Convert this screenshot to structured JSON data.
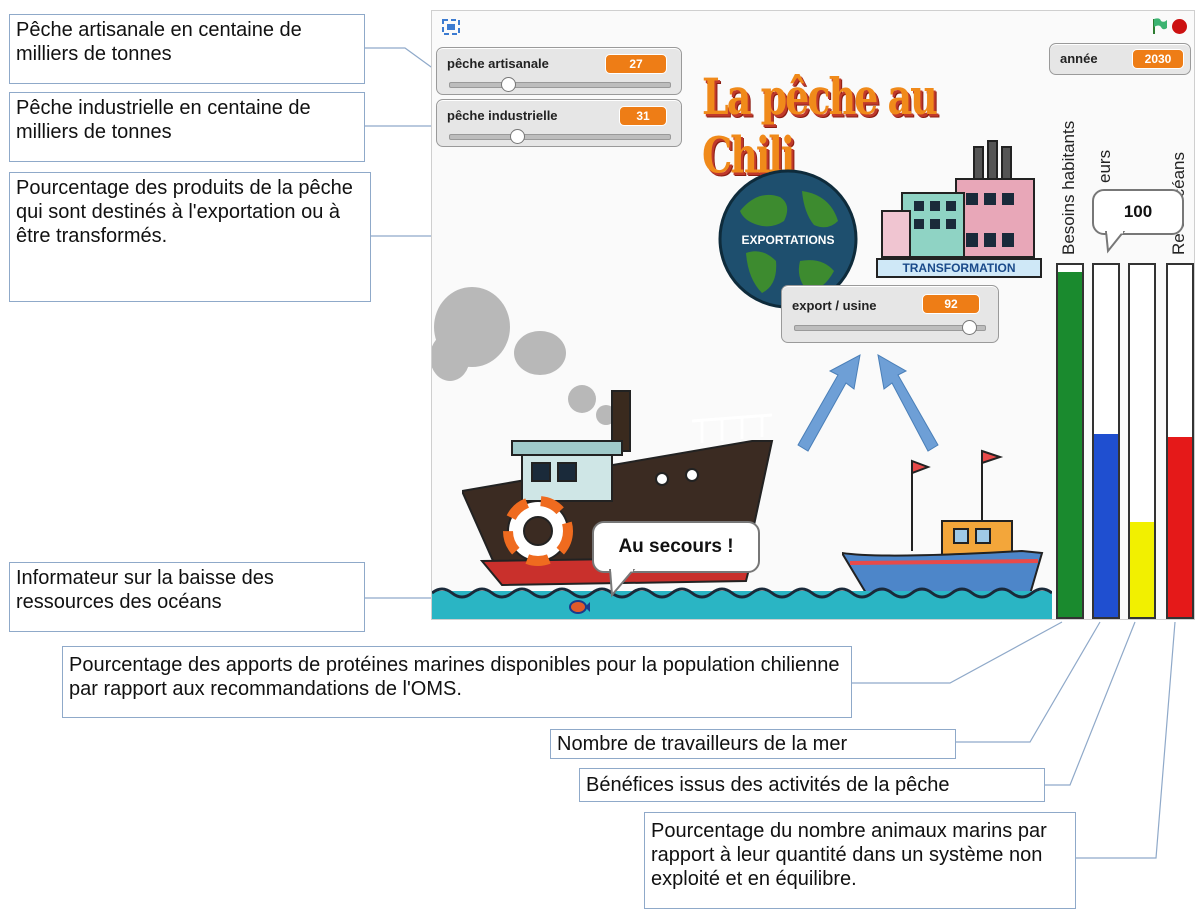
{
  "callouts": {
    "artisanal": "Pêche artisanale en centaine de milliers de tonnes",
    "industrial": "Pêche industrielle en centaine de milliers de tonnes",
    "export": "Pourcentage des produits de la pêche qui sont destinés à l'exportation ou à être transformés.",
    "informer": "Informateur sur la baisse des ressources des océans",
    "proteins": "Pourcentage des apports de protéines marines disponibles pour la population chilienne par rapport aux recommandations de l'OMS.",
    "workers": "Nombre de travailleurs de la mer",
    "profits": "Bénéfices issus des activités de la pêche",
    "animals": "Pourcentage du nombre animaux marins par rapport à leur quantité dans un système non exploité et en équilibre."
  },
  "sliders": [
    {
      "label": "pêche artisanale",
      "value": "27",
      "fraction": 0.27
    },
    {
      "label": "pêche industrielle",
      "value": "31",
      "fraction": 0.31
    },
    {
      "label": "export / usine",
      "value": "92",
      "fraction": 0.92
    }
  ],
  "year": {
    "label": "année",
    "value": "2030"
  },
  "title": "La pêche au Chili",
  "globe_label": "EXPORTATIONS",
  "factory_label": "TRANSFORMATION",
  "speech": {
    "boat": "Au secours !",
    "bar": "100"
  },
  "bars": [
    {
      "label": "Besoins habitants",
      "color": "#1a8a2e",
      "level": 0.98
    },
    {
      "label": "eurs",
      "color": "#1f4fd0",
      "level": 0.52
    },
    {
      "label": "",
      "color": "#f2f000",
      "level": 0.27
    },
    {
      "label": "Re ss océans",
      "color": "#e51919",
      "level": 0.51
    }
  ],
  "colors": {
    "accent_orange": "#ee7d16",
    "flag_green": "#3cb371",
    "stop_red": "#cc1111",
    "sea": "#2ab5c4"
  }
}
